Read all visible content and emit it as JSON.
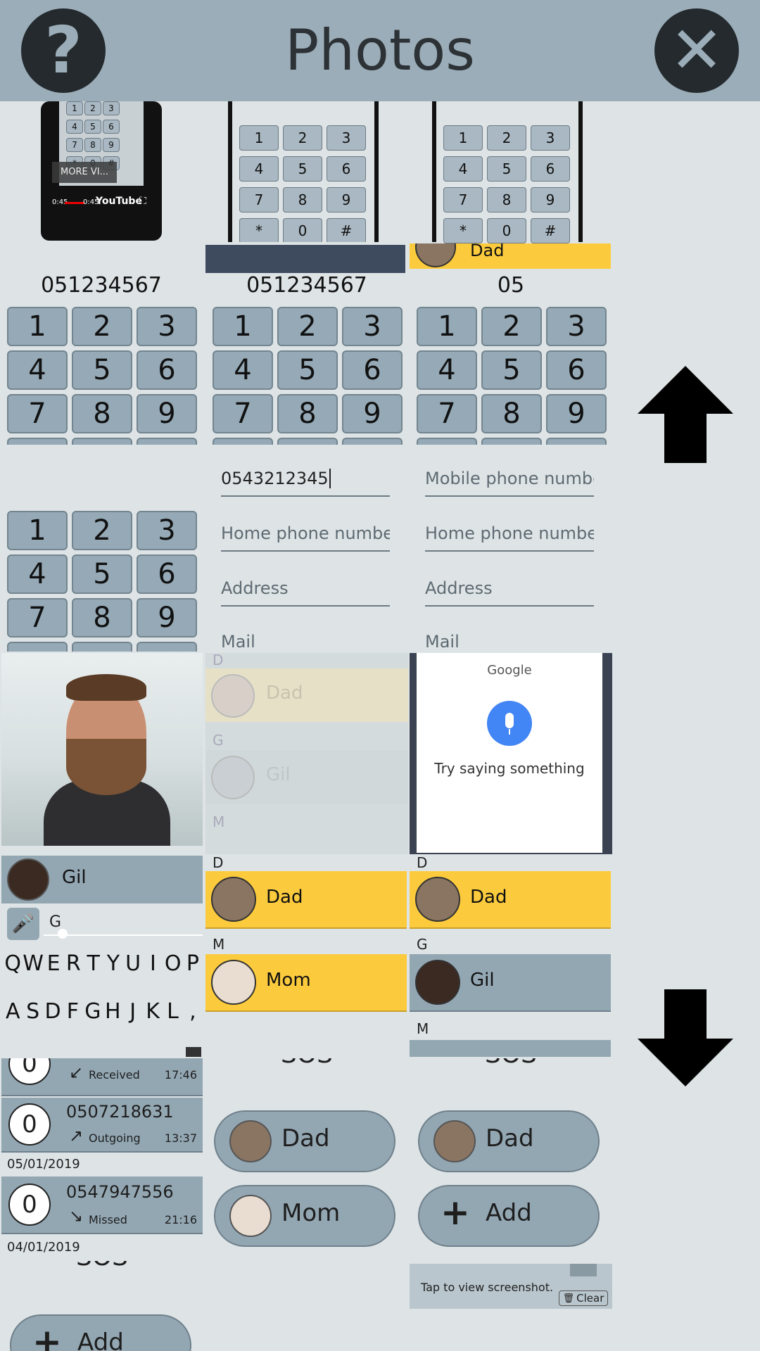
{
  "header": {
    "title": "Photos",
    "help_label": "?",
    "close_label": "✕"
  },
  "thumbs": {
    "t1": {
      "overlay": "MORE VI...",
      "time_left": "0:45",
      "time_right": "0:45",
      "brand": "YouTube",
      "keypad": [
        "1",
        "2",
        "3",
        "4",
        "5",
        "6",
        "7",
        "8",
        "9",
        "*",
        "0",
        "#"
      ]
    },
    "t2": {
      "keypad": [
        "1",
        "2",
        "3",
        "4",
        "5",
        "6",
        "7",
        "8",
        "9",
        "*",
        "0",
        "#"
      ]
    },
    "t3": {
      "keypad": [
        "1",
        "2",
        "3",
        "4",
        "5",
        "6",
        "7",
        "8",
        "9",
        "*",
        "0",
        "#"
      ],
      "contact": "Dad"
    },
    "t4": {
      "number": "051234567",
      "keypad": [
        "1",
        "2",
        "3",
        "4",
        "5",
        "6",
        "7",
        "8",
        "9"
      ]
    },
    "t5": {
      "number": "051234567",
      "keypad": [
        "1",
        "2",
        "3",
        "4",
        "5",
        "6",
        "7",
        "8",
        "9"
      ]
    },
    "t6": {
      "number": "05",
      "keypad": [
        "1",
        "2",
        "3",
        "4",
        "5",
        "6",
        "7",
        "8",
        "9"
      ]
    },
    "t7": {
      "keypad": [
        "1",
        "2",
        "3",
        "4",
        "5",
        "6",
        "7",
        "8",
        "9"
      ]
    },
    "t8": {
      "mobile_value": "0543212345",
      "home_placeholder": "Home phone number",
      "address_placeholder": "Address",
      "mail_placeholder": "Mail"
    },
    "t9": {
      "mobile_placeholder": "Mobile phone number",
      "home_placeholder": "Home phone number",
      "address_placeholder": "Address",
      "mail_placeholder": "Mail"
    },
    "t11": {
      "sec_d": "D",
      "name1": "Dad",
      "sec_g": "G",
      "name2": "Gil",
      "sec_m": "M"
    },
    "t12": {
      "google": "Google",
      "prompt": "Try saying something"
    },
    "t13": {
      "contact": "Gil",
      "search": "G",
      "row1": [
        "Q",
        "W",
        "E",
        "R",
        "T",
        "Y",
        "U",
        "I",
        "O",
        "P"
      ],
      "row2": [
        "A",
        "S",
        "D",
        "F",
        "G",
        "H",
        "J",
        "K",
        "L",
        ","
      ]
    },
    "t14": {
      "sec_d": "D",
      "name1": "Dad",
      "sec_m": "M",
      "name2": "Mom"
    },
    "t15": {
      "sec_d": "D",
      "name1": "Dad",
      "sec_g": "G",
      "name2": "Gil",
      "sec_m": "M"
    },
    "t16": {
      "first": {
        "count": "0",
        "type": "Received",
        "time": "17:46"
      },
      "second": {
        "count": "0",
        "number": "0507218631",
        "type": "Outgoing",
        "time": "13:37"
      },
      "date1": "05/01/2019",
      "third": {
        "count": "0",
        "number": "0547947556",
        "type": "Missed",
        "time": "21:16"
      },
      "date2": "04/01/2019"
    },
    "t17": {
      "sos": "SOS",
      "c1": "Dad",
      "c2": "Mom"
    },
    "t18": {
      "sos": "SOS",
      "c1": "Dad",
      "c2": "Add"
    },
    "t19": {
      "sos": "SOS",
      "add": "Add"
    },
    "t21": {
      "note": "Tap to view screenshot.",
      "clear": "Clear"
    }
  },
  "scroll": {
    "up_icon": "arrow-up-icon",
    "down_icon": "arrow-down-icon"
  },
  "colors": {
    "header_bg": "#9badb8",
    "page_bg": "#dee4e6",
    "highlight": "#fccb3d",
    "contact_row": "#93a7b3",
    "google_blue": "#4285f4"
  }
}
